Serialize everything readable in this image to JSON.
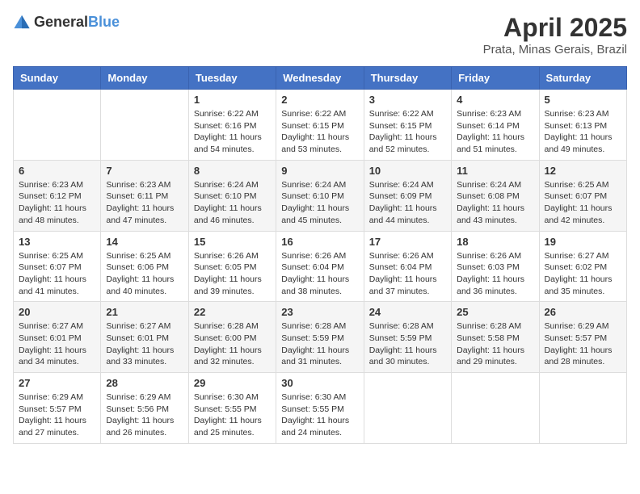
{
  "header": {
    "logo_general": "General",
    "logo_blue": "Blue",
    "month_title": "April 2025",
    "location": "Prata, Minas Gerais, Brazil"
  },
  "weekdays": [
    "Sunday",
    "Monday",
    "Tuesday",
    "Wednesday",
    "Thursday",
    "Friday",
    "Saturday"
  ],
  "weeks": [
    [
      {
        "day": "",
        "info": ""
      },
      {
        "day": "",
        "info": ""
      },
      {
        "day": "1",
        "info": "Sunrise: 6:22 AM\nSunset: 6:16 PM\nDaylight: 11 hours and 54 minutes."
      },
      {
        "day": "2",
        "info": "Sunrise: 6:22 AM\nSunset: 6:15 PM\nDaylight: 11 hours and 53 minutes."
      },
      {
        "day": "3",
        "info": "Sunrise: 6:22 AM\nSunset: 6:15 PM\nDaylight: 11 hours and 52 minutes."
      },
      {
        "day": "4",
        "info": "Sunrise: 6:23 AM\nSunset: 6:14 PM\nDaylight: 11 hours and 51 minutes."
      },
      {
        "day": "5",
        "info": "Sunrise: 6:23 AM\nSunset: 6:13 PM\nDaylight: 11 hours and 49 minutes."
      }
    ],
    [
      {
        "day": "6",
        "info": "Sunrise: 6:23 AM\nSunset: 6:12 PM\nDaylight: 11 hours and 48 minutes."
      },
      {
        "day": "7",
        "info": "Sunrise: 6:23 AM\nSunset: 6:11 PM\nDaylight: 11 hours and 47 minutes."
      },
      {
        "day": "8",
        "info": "Sunrise: 6:24 AM\nSunset: 6:10 PM\nDaylight: 11 hours and 46 minutes."
      },
      {
        "day": "9",
        "info": "Sunrise: 6:24 AM\nSunset: 6:10 PM\nDaylight: 11 hours and 45 minutes."
      },
      {
        "day": "10",
        "info": "Sunrise: 6:24 AM\nSunset: 6:09 PM\nDaylight: 11 hours and 44 minutes."
      },
      {
        "day": "11",
        "info": "Sunrise: 6:24 AM\nSunset: 6:08 PM\nDaylight: 11 hours and 43 minutes."
      },
      {
        "day": "12",
        "info": "Sunrise: 6:25 AM\nSunset: 6:07 PM\nDaylight: 11 hours and 42 minutes."
      }
    ],
    [
      {
        "day": "13",
        "info": "Sunrise: 6:25 AM\nSunset: 6:07 PM\nDaylight: 11 hours and 41 minutes."
      },
      {
        "day": "14",
        "info": "Sunrise: 6:25 AM\nSunset: 6:06 PM\nDaylight: 11 hours and 40 minutes."
      },
      {
        "day": "15",
        "info": "Sunrise: 6:26 AM\nSunset: 6:05 PM\nDaylight: 11 hours and 39 minutes."
      },
      {
        "day": "16",
        "info": "Sunrise: 6:26 AM\nSunset: 6:04 PM\nDaylight: 11 hours and 38 minutes."
      },
      {
        "day": "17",
        "info": "Sunrise: 6:26 AM\nSunset: 6:04 PM\nDaylight: 11 hours and 37 minutes."
      },
      {
        "day": "18",
        "info": "Sunrise: 6:26 AM\nSunset: 6:03 PM\nDaylight: 11 hours and 36 minutes."
      },
      {
        "day": "19",
        "info": "Sunrise: 6:27 AM\nSunset: 6:02 PM\nDaylight: 11 hours and 35 minutes."
      }
    ],
    [
      {
        "day": "20",
        "info": "Sunrise: 6:27 AM\nSunset: 6:01 PM\nDaylight: 11 hours and 34 minutes."
      },
      {
        "day": "21",
        "info": "Sunrise: 6:27 AM\nSunset: 6:01 PM\nDaylight: 11 hours and 33 minutes."
      },
      {
        "day": "22",
        "info": "Sunrise: 6:28 AM\nSunset: 6:00 PM\nDaylight: 11 hours and 32 minutes."
      },
      {
        "day": "23",
        "info": "Sunrise: 6:28 AM\nSunset: 5:59 PM\nDaylight: 11 hours and 31 minutes."
      },
      {
        "day": "24",
        "info": "Sunrise: 6:28 AM\nSunset: 5:59 PM\nDaylight: 11 hours and 30 minutes."
      },
      {
        "day": "25",
        "info": "Sunrise: 6:28 AM\nSunset: 5:58 PM\nDaylight: 11 hours and 29 minutes."
      },
      {
        "day": "26",
        "info": "Sunrise: 6:29 AM\nSunset: 5:57 PM\nDaylight: 11 hours and 28 minutes."
      }
    ],
    [
      {
        "day": "27",
        "info": "Sunrise: 6:29 AM\nSunset: 5:57 PM\nDaylight: 11 hours and 27 minutes."
      },
      {
        "day": "28",
        "info": "Sunrise: 6:29 AM\nSunset: 5:56 PM\nDaylight: 11 hours and 26 minutes."
      },
      {
        "day": "29",
        "info": "Sunrise: 6:30 AM\nSunset: 5:55 PM\nDaylight: 11 hours and 25 minutes."
      },
      {
        "day": "30",
        "info": "Sunrise: 6:30 AM\nSunset: 5:55 PM\nDaylight: 11 hours and 24 minutes."
      },
      {
        "day": "",
        "info": ""
      },
      {
        "day": "",
        "info": ""
      },
      {
        "day": "",
        "info": ""
      }
    ]
  ]
}
